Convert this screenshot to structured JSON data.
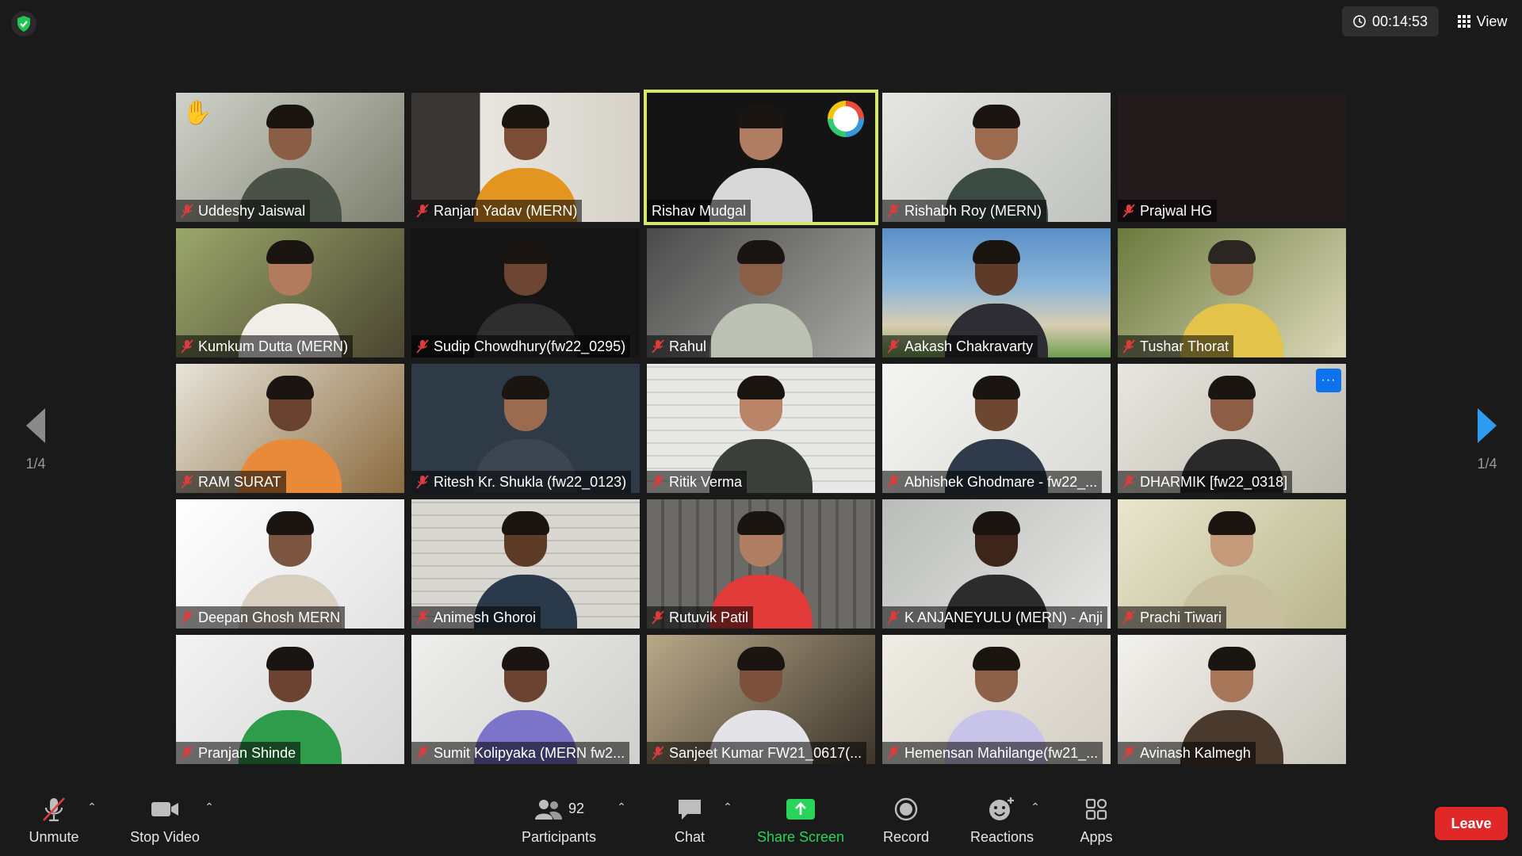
{
  "header": {
    "timer": "00:14:53",
    "view_label": "View"
  },
  "pager": {
    "left_label": "1/4",
    "right_label": "1/4"
  },
  "participants": [
    {
      "name": "Uddeshy Jaiswal",
      "muted": true,
      "raised_hand": true
    },
    {
      "name": "Ranjan Yadav (MERN)",
      "muted": true
    },
    {
      "name": "Rishav Mudgal",
      "muted": false,
      "active_speaker": true
    },
    {
      "name": "Rishabh Roy (MERN)",
      "muted": true
    },
    {
      "name": "Prajwal HG",
      "muted": true,
      "video_off": true
    },
    {
      "name": "Kumkum Dutta (MERN)",
      "muted": true
    },
    {
      "name": "Sudip Chowdhury(fw22_0295)",
      "muted": true
    },
    {
      "name": "Rahul",
      "muted": true
    },
    {
      "name": "Aakash Chakravarty",
      "muted": true
    },
    {
      "name": "Tushar Thorat",
      "muted": true
    },
    {
      "name": "RAM SURAT",
      "muted": true
    },
    {
      "name": "Ritesh Kr. Shukla (fw22_0123)",
      "muted": true
    },
    {
      "name": "Ritik Verma",
      "muted": true
    },
    {
      "name": "Abhishek Ghodmare - fw22_...",
      "muted": true
    },
    {
      "name": "DHARMIK [fw22_0318]",
      "muted": true,
      "more_button": "···"
    },
    {
      "name": "Deepan Ghosh MERN",
      "muted": true
    },
    {
      "name": "Animesh Ghoroi",
      "muted": true
    },
    {
      "name": "Rutuvik Patil",
      "muted": true
    },
    {
      "name": "K ANJANEYULU (MERN) - Anji",
      "muted": true
    },
    {
      "name": "Prachi Tiwari",
      "muted": true
    },
    {
      "name": "Pranjan Shinde",
      "muted": true
    },
    {
      "name": "Sumit Kolipyaka (MERN  fw2...",
      "muted": true
    },
    {
      "name": "Sanjeet Kumar FW21_0617(...",
      "muted": true
    },
    {
      "name": "Hemensan Mahilange(fw21_...",
      "muted": true
    },
    {
      "name": "Avinash Kalmegh",
      "muted": true
    }
  ],
  "toolbar": {
    "unmute": "Unmute",
    "stop_video": "Stop Video",
    "participants_count": "92",
    "participants": "Participants",
    "chat": "Chat",
    "share_screen": "Share Screen",
    "record": "Record",
    "reactions": "Reactions",
    "apps": "Apps",
    "leave": "Leave"
  },
  "colors": {
    "background": "#1a1a1a",
    "active_speaker_border": "#d5e86b",
    "share_screen_green": "#28d45a",
    "leave_red": "#e02828",
    "muted_mic_red": "#e03b3b"
  }
}
